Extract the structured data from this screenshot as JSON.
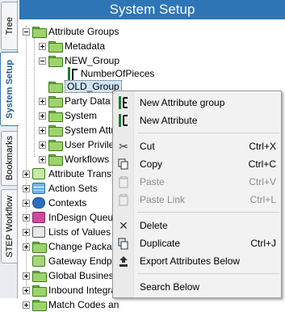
{
  "side_tabs": [
    {
      "label": "Tree"
    },
    {
      "label": "System Setup"
    },
    {
      "label": "Bookmarks"
    },
    {
      "label": "STEP Workflow"
    }
  ],
  "header": {
    "title": "System Setup"
  },
  "tree": {
    "attribute_groups": "Attribute Groups",
    "metadata": "Metadata",
    "new_group": "NEW_Group",
    "number_of_pieces": "NumberOfPieces",
    "old_group": "OLD_Group",
    "party_data": "Party Data",
    "system": "System",
    "system_attr": "System Attr",
    "user_privileges": "User Privileg",
    "workflows": "Workflows",
    "attribute_transformations": "Attribute Transf",
    "action_sets": "Action Sets",
    "contexts": "Contexts",
    "indesign_queue": "InDesign Queue",
    "lists_of_values": "Lists of Values /",
    "change_packages": "Change Packag",
    "gateway_endpoints": "Gateway Endpo",
    "global_business": "Global Business",
    "inbound_integration": "Inbound Integra",
    "match_codes": "Match Codes an"
  },
  "context_menu": {
    "items": [
      {
        "label": "New Attribute group",
        "shortcut": "",
        "icon": "new-attribute-group-icon",
        "enabled": true
      },
      {
        "label": "New Attribute",
        "shortcut": "",
        "icon": "new-attribute-icon",
        "enabled": true
      },
      {
        "label": "Cut",
        "shortcut": "Ctrl+X",
        "icon": "scissors-icon",
        "enabled": true
      },
      {
        "label": "Copy",
        "shortcut": "Ctrl+C",
        "icon": "copy-icon",
        "enabled": true
      },
      {
        "label": "Paste",
        "shortcut": "Ctrl+V",
        "icon": "paste-icon",
        "enabled": false
      },
      {
        "label": "Paste Link",
        "shortcut": "Ctrl+L",
        "icon": "paste-link-icon",
        "enabled": false
      },
      {
        "label": "Delete",
        "shortcut": "",
        "icon": "delete-x-icon",
        "enabled": true
      },
      {
        "label": "Duplicate",
        "shortcut": "Ctrl+J",
        "icon": "duplicate-icon",
        "enabled": true
      },
      {
        "label": "Export Attributes Below",
        "shortcut": "",
        "icon": "export-icon",
        "enabled": true
      },
      {
        "label": "Search Below",
        "shortcut": "",
        "icon": "",
        "enabled": true
      }
    ]
  },
  "colors": {
    "header_bg": "#2e75b6",
    "folder_green": "#9ed36a",
    "selection": "#cfe4f8"
  }
}
